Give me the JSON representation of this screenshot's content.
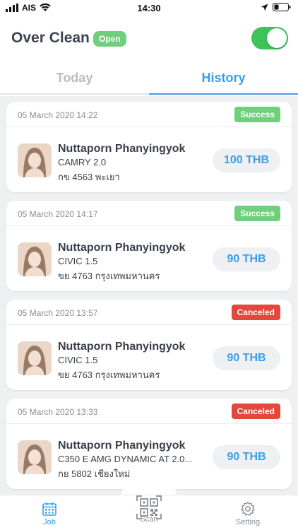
{
  "status_bar": {
    "carrier": "AIS",
    "time": "14:30"
  },
  "app": {
    "title": "Over Clean",
    "open_badge": "Open",
    "toggle_on": true
  },
  "tabs": [
    {
      "label": "Today",
      "active": false
    },
    {
      "label": "History",
      "active": true
    }
  ],
  "orders": [
    {
      "datetime": "05 March 2020 14:22",
      "status": "Success",
      "name": "Nuttaporn Phanyingyok",
      "car": "CAMRY 2.0",
      "plate": "กข 4563 พะเยา",
      "price": "100 THB"
    },
    {
      "datetime": "05 March 2020 14:17",
      "status": "Success",
      "name": "Nuttaporn Phanyingyok",
      "car": "CIVIC 1.5",
      "plate": "ขย 4763 กรุงเทพมหานคร",
      "price": "90 THB"
    },
    {
      "datetime": "05 March 2020 13:57",
      "status": "Canceled",
      "name": "Nuttaporn Phanyingyok",
      "car": "CIVIC 1.5",
      "plate": "ขย 4763 กรุงเทพมหานคร",
      "price": "90 THB"
    },
    {
      "datetime": "05 March 2020 13:33",
      "status": "Canceled",
      "name": "Nuttaporn Phanyingyok",
      "car": "C350 E AMG DYNAMIC AT 2.0...",
      "plate": "กย 5802 เชียงใหม่",
      "price": "90 THB"
    }
  ],
  "bottom_nav": {
    "job": "Job",
    "scan": "Scan",
    "setting": "Setting"
  },
  "colors": {
    "accent": "#3a9fe6",
    "success": "#6fcf7c",
    "canceled": "#e2483c",
    "toggle": "#3cc35a"
  },
  "icons": {
    "job": "calendar-icon",
    "scan": "qr-code-icon",
    "setting": "gear-icon"
  }
}
